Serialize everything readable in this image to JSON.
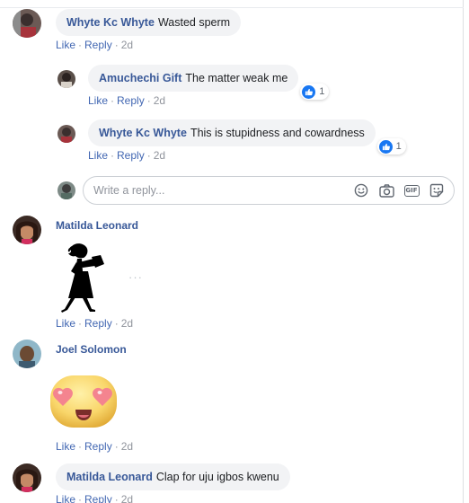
{
  "actions": {
    "like": "Like",
    "reply": "Reply",
    "sep": "·"
  },
  "comments": [
    {
      "author": "Whyte Kc Whyte",
      "text": "Wasted sperm",
      "time": "2d"
    },
    {
      "author": "Amuchechi Gift",
      "text": "The matter weak me",
      "time": "2d",
      "reactions": "1"
    },
    {
      "author": "Whyte Kc Whyte",
      "text": "This is stupidness and cowardness",
      "time": "2d",
      "reactions": "1"
    },
    {
      "author": "Matilda Leonard",
      "sticker": "dancing-girl-silhouette",
      "time": "2d"
    },
    {
      "author": "Joel Solomon",
      "sticker": "heart-eyes-emoji",
      "time": "2d"
    },
    {
      "author": "Matilda Leonard",
      "text": "Clap for uju igbos kwenu",
      "time": "2d"
    }
  ],
  "reply_box": {
    "placeholder": "Write a reply..."
  },
  "more_dots": "···",
  "colors": {
    "link": "#385898",
    "action": "#4267b2",
    "bubble": "#f2f3f5",
    "like": "#1877f2"
  }
}
